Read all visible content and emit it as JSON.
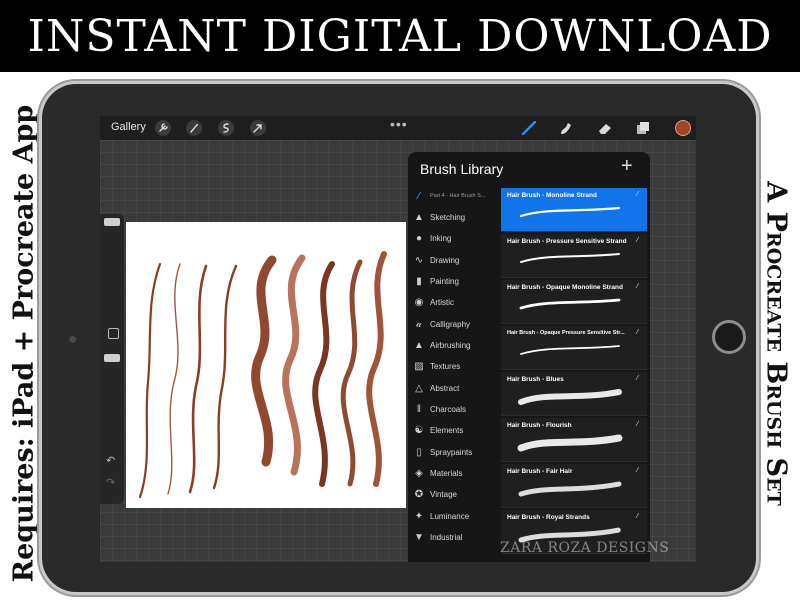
{
  "banner": {
    "title": "INSTANT DIGITAL DOWNLOAD"
  },
  "side": {
    "left_text": "Requires: iPad + Procreate App",
    "right_text": "A Procreate Brush Set"
  },
  "watermark": "ZARA ROZA DESIGNS",
  "app": {
    "gallery_label": "Gallery",
    "top_icons": [
      "wrench-icon",
      "magic-wand-icon",
      "selection-icon",
      "transform-arrow-icon"
    ],
    "more_label": "•••",
    "tools": [
      "brush-icon",
      "smudge-icon",
      "eraser-icon",
      "layers-icon"
    ],
    "current_color": "#a0452b",
    "accent_color": "#1174ea"
  },
  "brush_library": {
    "title": "Brush Library",
    "add_label": "+",
    "categories": [
      {
        "label": "Part 4 - Hair Brush S...",
        "icon": "brush-stroke-icon"
      },
      {
        "label": "Sketching",
        "icon": "pencil-tip-icon"
      },
      {
        "label": "Inking",
        "icon": "ink-drop-icon"
      },
      {
        "label": "Drawing",
        "icon": "squiggle-icon"
      },
      {
        "label": "Painting",
        "icon": "paint-brush-icon"
      },
      {
        "label": "Artistic",
        "icon": "palette-icon"
      },
      {
        "label": "Calligraphy",
        "icon": "calligraphy-icon"
      },
      {
        "label": "Airbrushing",
        "icon": "airbrush-icon"
      },
      {
        "label": "Textures",
        "icon": "texture-icon"
      },
      {
        "label": "Abstract",
        "icon": "triangle-icon"
      },
      {
        "label": "Charcoals",
        "icon": "charcoal-icon"
      },
      {
        "label": "Elements",
        "icon": "yin-yang-icon"
      },
      {
        "label": "Spraypaints",
        "icon": "spray-can-icon"
      },
      {
        "label": "Materials",
        "icon": "cube-icon"
      },
      {
        "label": "Vintage",
        "icon": "star-badge-icon"
      },
      {
        "label": "Luminance",
        "icon": "sparkle-icon"
      },
      {
        "label": "Industrial",
        "icon": "anvil-icon"
      }
    ],
    "brushes": [
      {
        "name": "Hair Brush - Monoline Strand"
      },
      {
        "name": "Hair Brush - Pressure Sensitive Strand"
      },
      {
        "name": "Hair Brush - Opaque Monoline Strand"
      },
      {
        "name": "Hair Brush - Opaque Pressure Sensitive Str..."
      },
      {
        "name": "Hair Brush - Blues"
      },
      {
        "name": "Hair Brush - Flourish"
      },
      {
        "name": "Hair Brush - Fair Hair"
      },
      {
        "name": "Hair Brush - Royal Strands"
      }
    ],
    "selected_brush_index": 0,
    "selected_category_index": 0
  }
}
